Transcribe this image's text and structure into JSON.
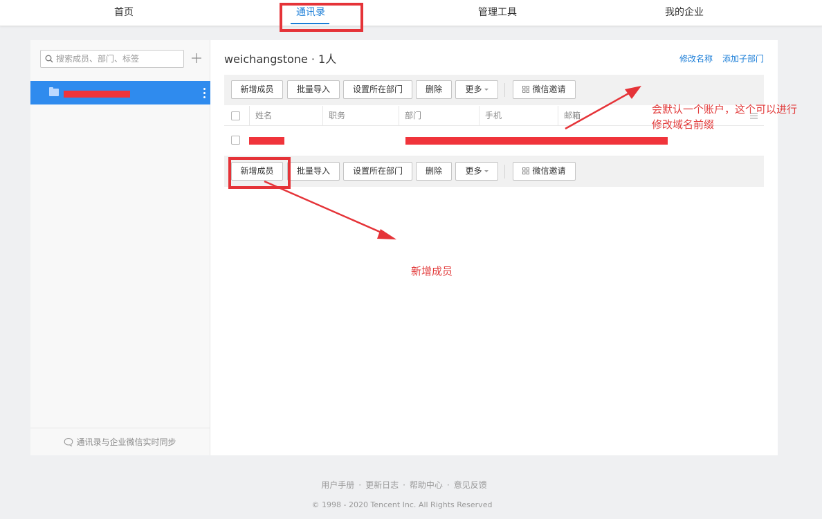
{
  "nav": {
    "items": [
      {
        "label": "首页"
      },
      {
        "label": "通讯录"
      },
      {
        "label": "管理工具"
      },
      {
        "label": "我的企业"
      }
    ]
  },
  "sidebar": {
    "search_placeholder": "搜索成员、部门、标签",
    "sync_text": "通讯录与企业微信实时同步"
  },
  "content": {
    "title": "weichangstone · 1人",
    "rename_link": "修改名称",
    "add_subdept_link": "添加子部门"
  },
  "toolbar": {
    "add_member": "新增成员",
    "batch_import": "批量导入",
    "set_dept": "设置所在部门",
    "delete": "删除",
    "more": "更多",
    "wechat_invite": "微信邀请"
  },
  "table": {
    "columns": [
      "姓名",
      "职务",
      "部门",
      "手机",
      "邮箱"
    ]
  },
  "annotations": {
    "account_note_line1": "会默认一个账户，这个可以进行",
    "account_note_line2": "修改域名前缀",
    "add_member_note": "新增成员"
  },
  "footer": {
    "links": [
      "用户手册",
      "更新日志",
      "帮助中心",
      "意见反馈"
    ],
    "copyright": "© 1998 - 2020 Tencent Inc. All Rights Reserved"
  },
  "colors": {
    "accent": "#1a7dd7",
    "selected_dept": "#2f8bee",
    "annotation_red": "#e53338"
  }
}
